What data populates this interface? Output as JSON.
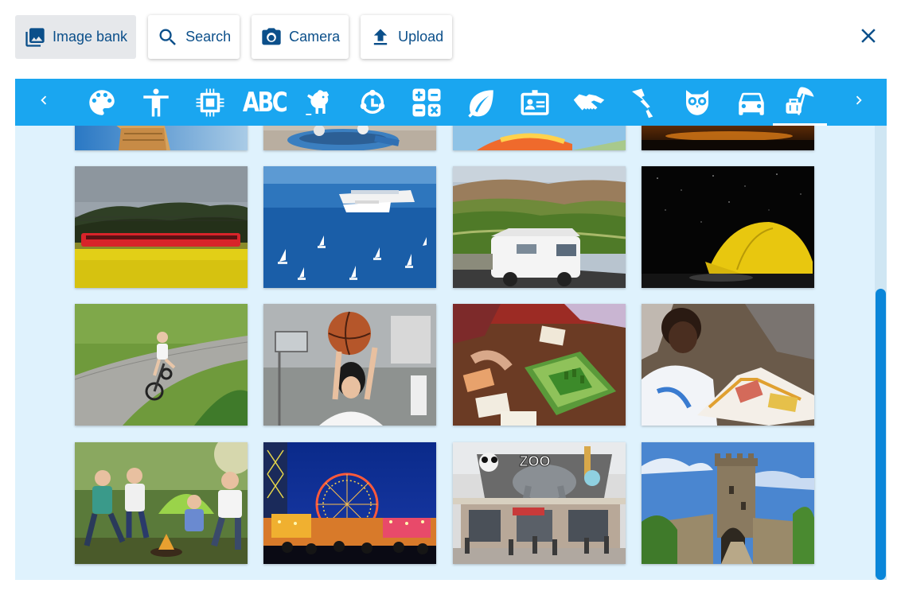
{
  "toolbar": {
    "image_bank_label": "Image bank",
    "search_label": "Search",
    "camera_label": "Camera",
    "upload_label": "Upload"
  },
  "categories": [
    {
      "icon": "palette-icon"
    },
    {
      "icon": "person-icon"
    },
    {
      "icon": "chip-icon"
    },
    {
      "icon": "abc-icon",
      "text": "ABC"
    },
    {
      "icon": "dog-icon"
    },
    {
      "icon": "cycle-arrows-icon"
    },
    {
      "icon": "calculator-icon"
    },
    {
      "icon": "leaf-icon"
    },
    {
      "icon": "id-card-icon"
    },
    {
      "icon": "handshake-icon"
    },
    {
      "icon": "map-pin-icon"
    },
    {
      "icon": "owl-icon"
    },
    {
      "icon": "car-icon"
    },
    {
      "icon": "beach-luggage-icon",
      "selected": true
    }
  ],
  "gallery": {
    "images": [
      {
        "name": "ice-cream-cone-photo"
      },
      {
        "name": "swing-rope-photo"
      },
      {
        "name": "balloon-photo"
      },
      {
        "name": "sunset-photo"
      },
      {
        "name": "red-train-rapeseed-photo"
      },
      {
        "name": "cruise-ships-harbor-photo"
      },
      {
        "name": "camper-van-landscape-photo"
      },
      {
        "name": "tent-night-sky-photo"
      },
      {
        "name": "child-cycling-photo"
      },
      {
        "name": "girl-basketball-photo"
      },
      {
        "name": "board-game-photo"
      },
      {
        "name": "boy-reading-book-photo"
      },
      {
        "name": "kids-campfire-photo"
      },
      {
        "name": "fairground-night-photo"
      },
      {
        "name": "zoo-entrance-photo"
      },
      {
        "name": "castle-tower-photo"
      }
    ],
    "zoo_sign_text": "ZOO"
  },
  "colors": {
    "accent": "#1aa6f0",
    "brand_dark": "#0b4f8a",
    "gallery_bg": "#dff2fd",
    "scrollbar": "#0a86d9"
  }
}
